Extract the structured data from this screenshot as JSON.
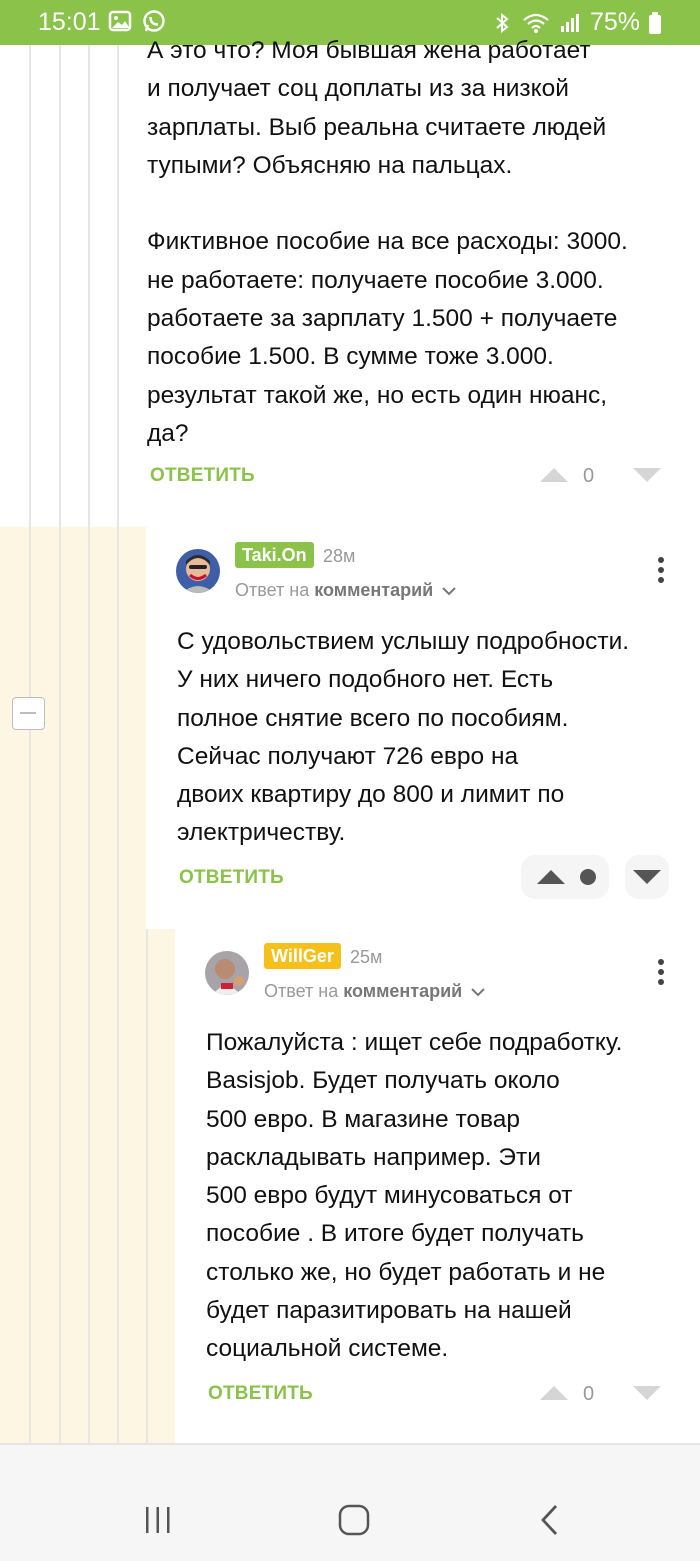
{
  "status_bar": {
    "time": "15:01",
    "battery": "75%",
    "icons": [
      "gallery-icon",
      "whatsapp-icon",
      "bluetooth-icon",
      "wifi-icon",
      "signal-icon",
      "battery-icon"
    ]
  },
  "colors": {
    "accent": "#8ac24a",
    "highlight": "#fdf6e3",
    "nick_taki": "#8ac24a",
    "nick_willger": "#f5c01a"
  },
  "comments": [
    {
      "text": "А это что? Моя бывшая жена работает\nи получает соц доплаты из за низкой\nзарплаты. Выб реальна считаете людей\nтупыми? Объясняю на пальцах.\n\nФиктивное пособие на все расходы: 3000.\nне работаете: получаете пособие 3.000.\nработаете за зарплату 1.500 + получаете\nпособие 1.500. В сумме тоже 3.000.\nрезультат такой же, но есть один нюанс,\nда?",
      "reply_label": "ОТВЕТИТЬ",
      "score": "0"
    },
    {
      "author": "Taki.On",
      "age": "28м",
      "answer_prefix": "Ответ на",
      "answer_link": "комментарий",
      "text": "С удовольствием услышу подробности.\nУ них ничего подобного нет. Есть\nполное снятие всего по пособиям.\nСейчас получают 726 евро на\nдвоих квартиру до 800 и лимит по\nэлектричеству.",
      "reply_label": "ОТВЕТИТЬ",
      "score": ""
    },
    {
      "author": "WillGer",
      "age": "25м",
      "answer_prefix": "Ответ на",
      "answer_link": "комментарий",
      "text": "Пожалуйста : ищет себе подработку.\nBasisjob. Будет получать около\n500 евро. В магазине товар\nраскладывать например. Эти\n500 евро будут минусоваться от\nпособие . В итоге будет получать\nстолько же, но будет работать и не\nбудет паразитировать на нашей\nсоциальной системе.",
      "reply_label": "ОТВЕТИТЬ",
      "score": "0"
    }
  ]
}
